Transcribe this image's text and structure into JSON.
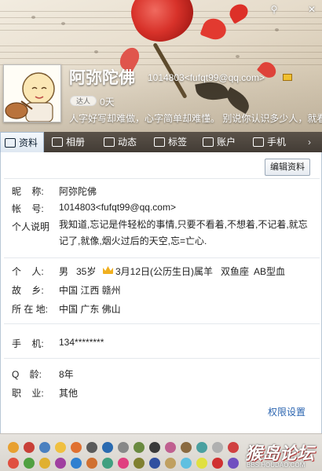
{
  "window": {
    "minimize_glyph": "⚲",
    "close_glyph": "✕"
  },
  "profile": {
    "nickname": "阿弥陀佛",
    "qq_and_email": "1014803<fufqt99@qq.com>",
    "level_badge": "达人",
    "level_days": "0天",
    "signature": "人字好写却难做，心字简单却难懂。 别说你认识多少人，就看你..."
  },
  "tabs": [
    {
      "label": "资料",
      "icon": "profile-card-icon"
    },
    {
      "label": "相册",
      "icon": "photo-album-icon"
    },
    {
      "label": "动态",
      "icon": "feed-icon"
    },
    {
      "label": "标签",
      "icon": "tag-icon"
    },
    {
      "label": "账户",
      "icon": "wallet-icon"
    },
    {
      "label": "手机",
      "icon": "mobile-phone-icon"
    }
  ],
  "actions": {
    "edit_profile": "编辑资料",
    "privacy_settings": "权限设置"
  },
  "fields": {
    "nickname_label": "昵    称:",
    "nickname_value": "阿弥陀佛",
    "account_label": "帐    号:",
    "account_value": "1014803<fufqt99@qq.com>",
    "intro_label": "个人说明",
    "intro_value": "我知道,忘记是件轻松的事情,只要不看着,不想着,不记着,就忘记了,就像,烟火过后的天空,忘=亡心.",
    "personal_label": "个    人:",
    "gender": "男",
    "age": "35岁",
    "birthday": "3月12日(公历生日)",
    "zodiac": "属羊",
    "constellation": "双鱼座",
    "blood_type": "AB型血",
    "hometown_label": "故    乡:",
    "hometown_value": "中国 江西 赣州",
    "location_label": "所 在 地:",
    "location_value": "中国 广东 佛山",
    "mobile_label": "手    机:",
    "mobile_value": "134********",
    "qq_age_label": "Q    龄:",
    "qq_age_value": "8年",
    "occupation_label": "职    业:",
    "occupation_value": "其他"
  },
  "watermark": {
    "title": "猴岛论坛",
    "url": "BBS.HOUDAO.COM"
  },
  "colors": {
    "tabbar": "#4a433b",
    "link": "#2a64b0",
    "accent_rose": "#d8322a"
  }
}
